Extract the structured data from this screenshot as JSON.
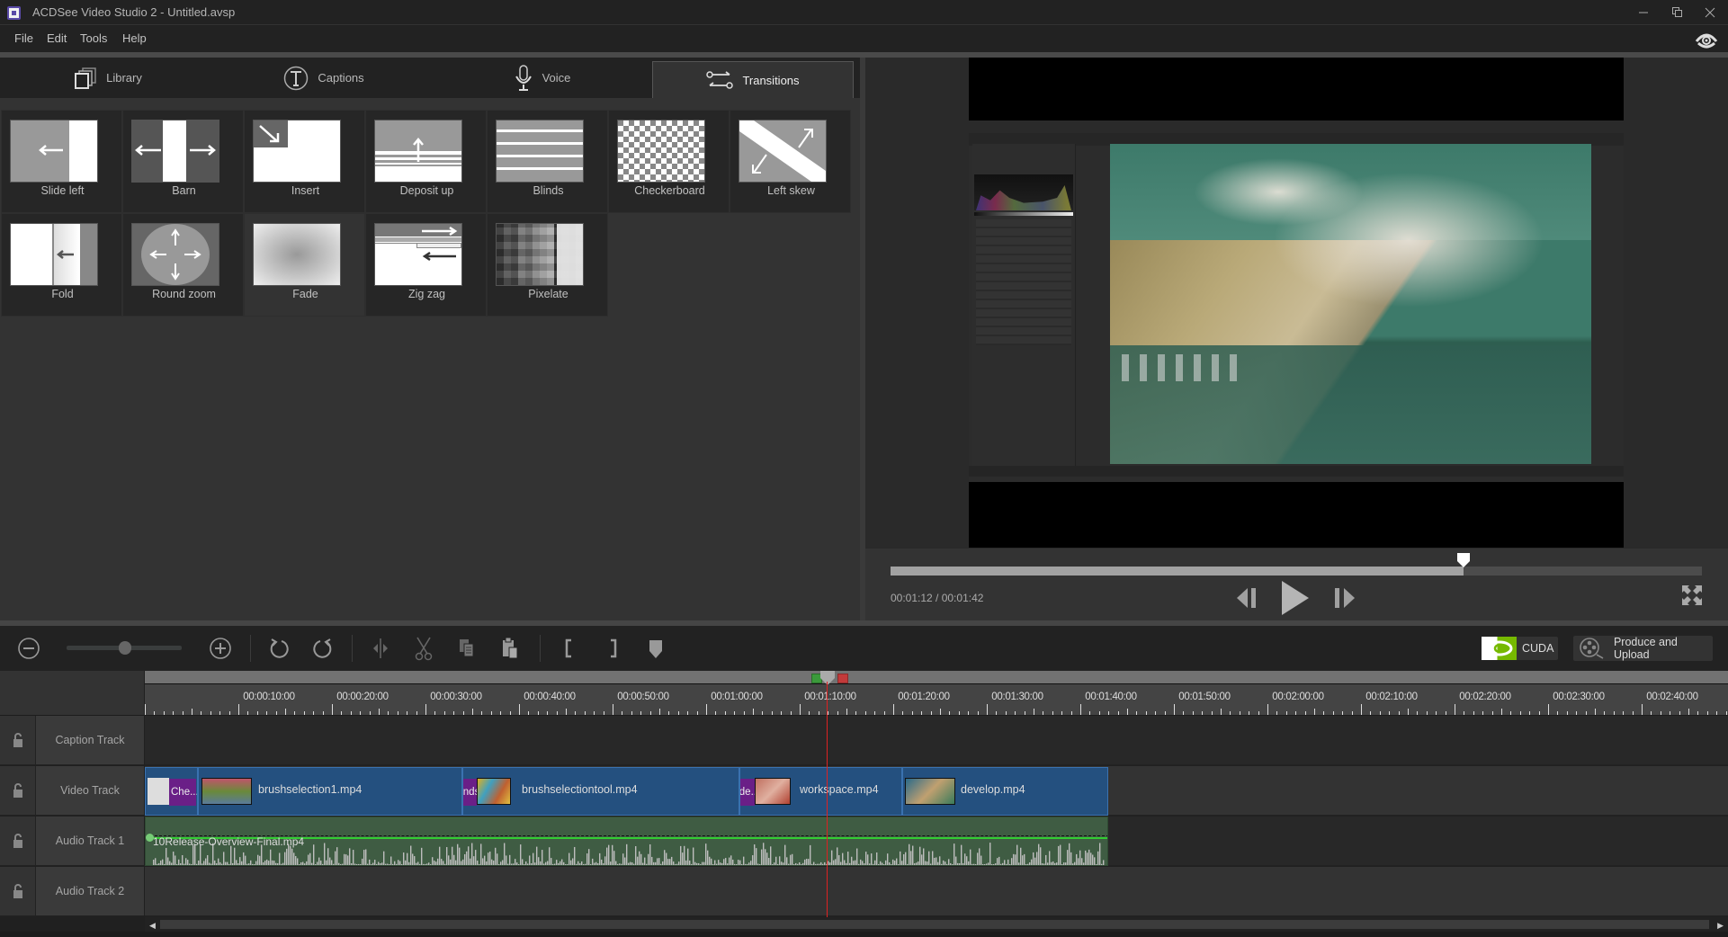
{
  "window": {
    "title": "ACDSee Video Studio 2 - Untitled.avsp",
    "controls": [
      "minimize",
      "restore",
      "close"
    ]
  },
  "menu": [
    "File",
    "Edit",
    "Tools",
    "Help"
  ],
  "tabs": [
    {
      "label": "Library",
      "icon": "library-icon",
      "active": false
    },
    {
      "label": "Captions",
      "icon": "captions-icon",
      "active": false
    },
    {
      "label": "Voice",
      "icon": "microphone-icon",
      "active": false
    },
    {
      "label": "Transitions",
      "icon": "transitions-icon",
      "active": true
    }
  ],
  "transitions": [
    {
      "label": "Slide left",
      "kind": "slide-left"
    },
    {
      "label": "Barn",
      "kind": "barn"
    },
    {
      "label": "Insert",
      "kind": "insert"
    },
    {
      "label": "Deposit up",
      "kind": "deposit-up"
    },
    {
      "label": "Blinds",
      "kind": "blinds"
    },
    {
      "label": "Checkerboard",
      "kind": "checkerboard"
    },
    {
      "label": "Left skew",
      "kind": "left-skew"
    },
    {
      "label": "Fold",
      "kind": "fold"
    },
    {
      "label": "Round zoom",
      "kind": "round-zoom"
    },
    {
      "label": "Fade",
      "kind": "fade",
      "selected": true
    },
    {
      "label": "Zig zag",
      "kind": "zig-zag"
    },
    {
      "label": "Pixelate",
      "kind": "pixelate"
    }
  ],
  "player": {
    "current_time": "00:01:12",
    "total_time": "00:01:42",
    "readout": "00:01:12 / 00:01:42",
    "progress": 0.706
  },
  "toolbar": {
    "cuda_label": "CUDA",
    "produce_label": "Produce and Upload"
  },
  "timeline": {
    "ruler_labels": [
      "00:00:10:00",
      "00:00:20:00",
      "00:00:30:00",
      "00:00:40:00",
      "00:00:50:00",
      "00:01:00:00",
      "00:01:10:00",
      "00:01:20:00",
      "00:01:30:00",
      "00:01:40:00",
      "00:01:50:00",
      "00:02:00:00",
      "00:02:10:00",
      "00:02:20:00",
      "00:02:30:00",
      "00:02:40:00"
    ],
    "playhead_time": "00:01:12",
    "tracks": [
      {
        "label": "Caption Track",
        "locked": false
      },
      {
        "label": "Video Track",
        "locked": false
      },
      {
        "label": "Audio Track 1",
        "locked": false
      },
      {
        "label": "Audio Track 2",
        "locked": false
      }
    ],
    "video_clips": [
      {
        "name": "",
        "transition": "Che..."
      },
      {
        "name": "brushselection1.mp4",
        "transition": ""
      },
      {
        "name": "brushselectiontool.mp4",
        "transition": "Blinds"
      },
      {
        "name": "workspace.mp4",
        "transition": "Slide..."
      },
      {
        "name": "develop.mp4",
        "transition": ""
      }
    ],
    "audio_clip": {
      "name": "10Release-Overview-Final.mp4"
    }
  },
  "colors": {
    "video_clip": "#24507f",
    "audio_clip": "#3f5c43",
    "transition_badge": "#6a1f87",
    "playhead": "#dd2222",
    "cuda_green": "#76b900"
  }
}
